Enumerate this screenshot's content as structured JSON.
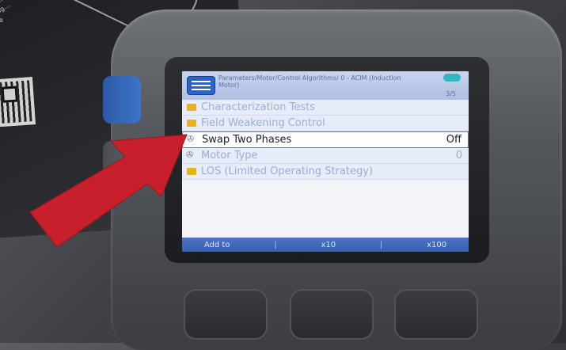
{
  "card": {
    "text": "For more inf... by scanning... (Available"
  },
  "screen": {
    "breadcrumb": "Parameters/Motor/Control Algorithms/ 0 - ACIM (Induction Motor)",
    "page_indicator": "3/5",
    "items": [
      {
        "label": "Characterization Tests",
        "value": "",
        "icon": "folder-icon"
      },
      {
        "label": "Field Weakening Control",
        "value": "",
        "icon": "folder-icon"
      },
      {
        "label": "Swap Two Phases",
        "value": "Off",
        "icon": "parameter-icon",
        "selected": true
      },
      {
        "label": "Motor Type",
        "value": "0",
        "icon": "parameter-icon"
      },
      {
        "label": "LOS (Limited Operating Strategy)",
        "value": "",
        "icon": "folder-icon"
      }
    ],
    "softkeys": {
      "left": "Add to",
      "middle": "x10",
      "right": "x100"
    }
  },
  "colors": {
    "arrow": "#c8202b",
    "header": "#2d63c7",
    "softkey_bar": "#3660b0"
  }
}
